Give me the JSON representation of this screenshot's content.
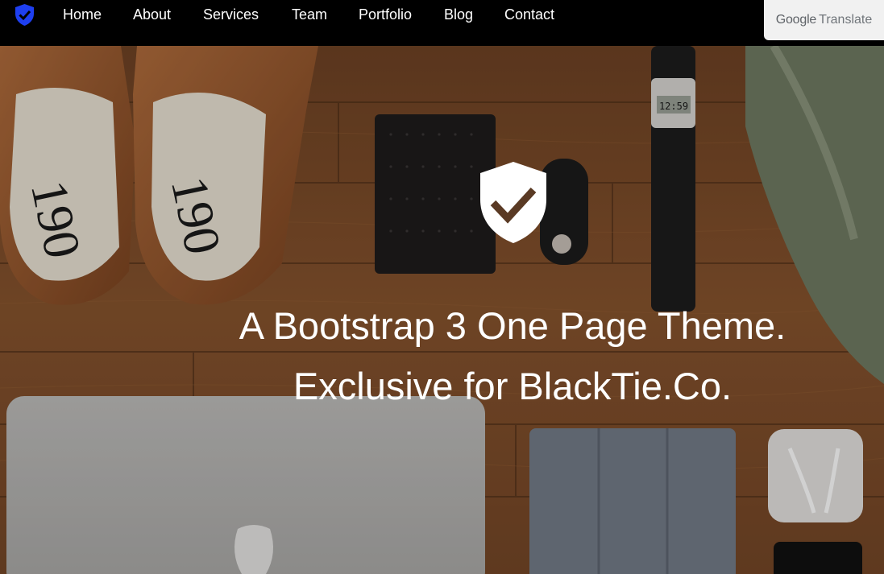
{
  "navbar": {
    "brand_icon": "shield-check-icon",
    "brand_color": "#1e3ff0",
    "links": [
      {
        "label": "Home"
      },
      {
        "label": "About"
      },
      {
        "label": "Services"
      },
      {
        "label": "Team"
      },
      {
        "label": "Portfolio"
      },
      {
        "label": "Blog"
      },
      {
        "label": "Contact"
      }
    ]
  },
  "google_translate": {
    "google": "Google",
    "translate": "Translate"
  },
  "hero": {
    "icon": "shield-check-icon",
    "headline_line1": "A Bootstrap 3 One Page Theme.",
    "headline_line2": "Exclusive for BlackTie.Co.",
    "watch_display": "12:59",
    "shoe_label": "190"
  },
  "colors": {
    "navbar_bg": "#000000",
    "wood": "#7a4a28",
    "text": "#ffffff"
  }
}
